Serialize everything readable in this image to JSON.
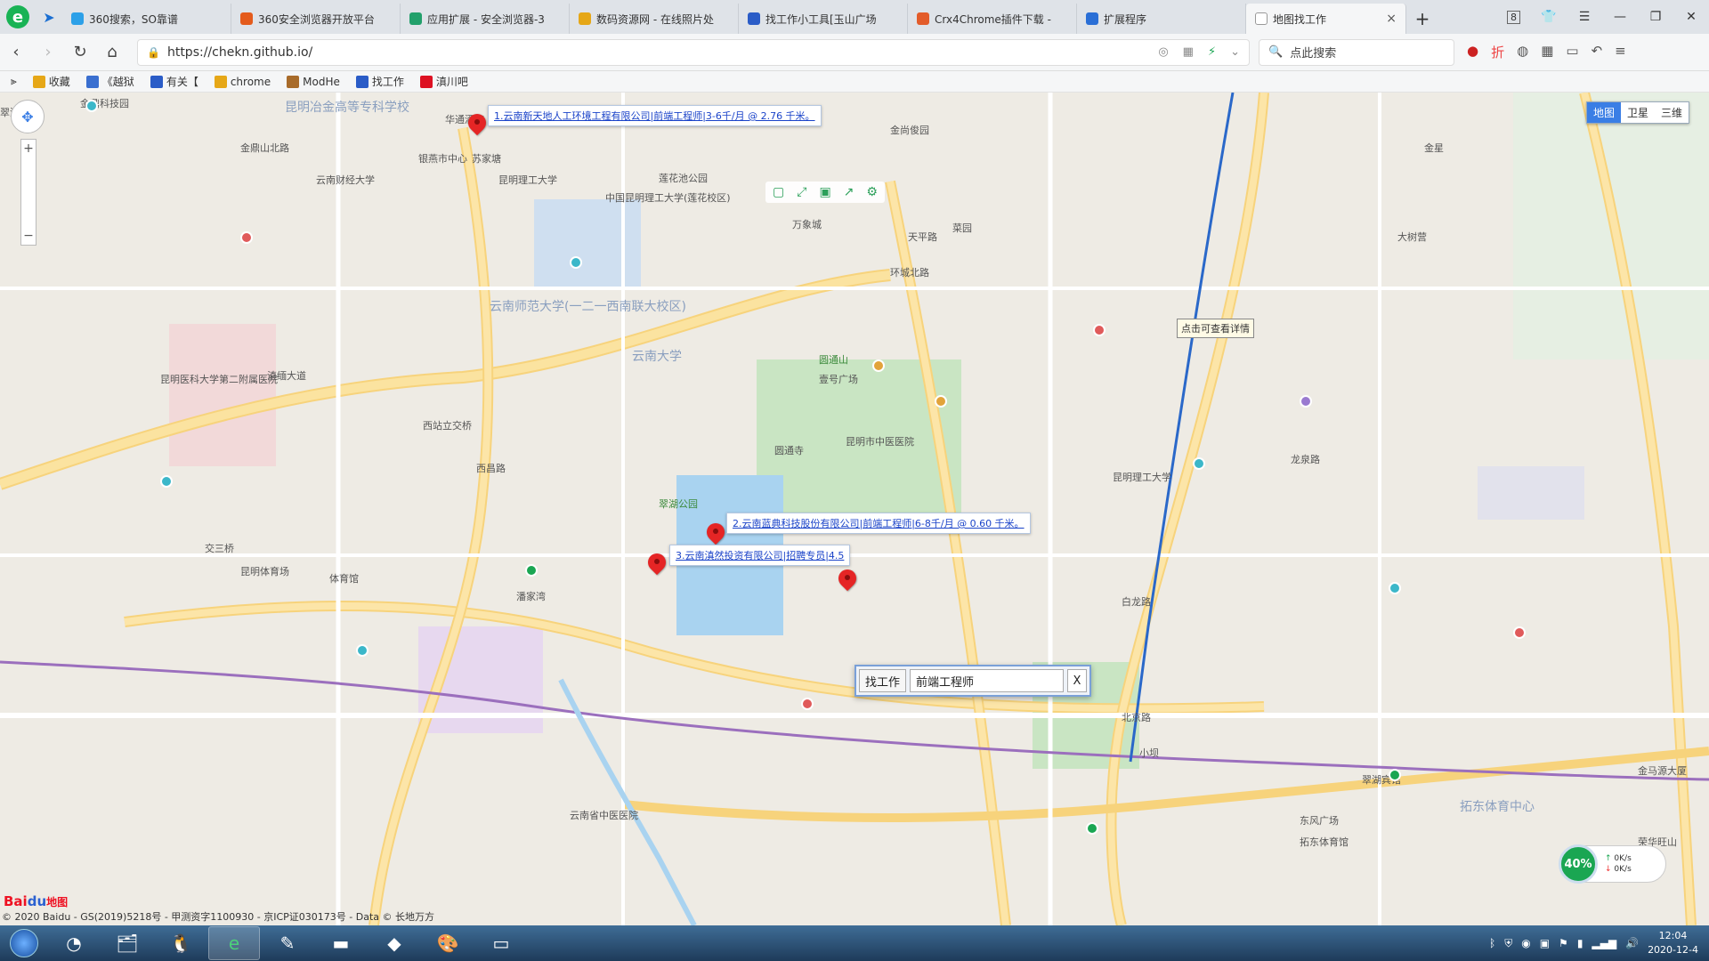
{
  "browser": {
    "tabs": [
      {
        "label": "360搜索，SO靠谱",
        "color": "#2ca0e8",
        "icon": "search-icon"
      },
      {
        "label": "360安全浏览器开放平台",
        "color": "#e45b1c",
        "icon": "grid-icon"
      },
      {
        "label": "应用扩展 - 安全浏览器-3",
        "color": "#22a06b",
        "icon": "extension-icon"
      },
      {
        "label": "数码资源网 - 在线照片处",
        "color": "#e6a717",
        "icon": "folder-icon"
      },
      {
        "label": "找工作小工具[玉山广场",
        "color": "#2a5cc7",
        "icon": "tool-icon"
      },
      {
        "label": "Crx4Chrome插件下载 -",
        "color": "#e35c2a",
        "icon": "rainbow-icon"
      },
      {
        "label": "扩展程序",
        "color": "#2a6fd6",
        "icon": "puzzle-icon"
      }
    ],
    "active_tab": {
      "label": "地图找工作",
      "close": "×"
    },
    "new_tab": "+",
    "tab_count": "8",
    "url": "https://chekn.github.io/",
    "search_placeholder": "点此搜索"
  },
  "bookmarks": [
    {
      "label": "收藏",
      "color": "#e6a717"
    },
    {
      "label": "《越狱",
      "color": "#3a6fd0"
    },
    {
      "label": "有关【",
      "color": "#2a5cc7"
    },
    {
      "label": "chrome",
      "color": "#e6a717"
    },
    {
      "label": "ModHe",
      "color": "#a86b2a"
    },
    {
      "label": "找工作",
      "color": "#2a5cc7"
    },
    {
      "label": "滇川吧",
      "color": "#d12"
    }
  ],
  "map": {
    "map_types": [
      "地图",
      "卫星",
      "三维"
    ],
    "active_map_type": "地图",
    "jobs": [
      {
        "label": "1.云南新天地人工环境工程有限公司|前端工程师|3-6千/月 @ 2.76 千米。"
      },
      {
        "label": "2.云南蓝典科技股份有限公司|前端工程师|6-8千/月 @ 0.60 千米。"
      },
      {
        "label": "3.云南滇然投资有限公司|招聘专员|4.5"
      }
    ],
    "tip": "点击可查看详情",
    "search_widget": {
      "button": "找工作",
      "value": "前端工程师",
      "close": "X"
    },
    "places": [
      "金鼎科技园",
      "昆明冶金高等专科学校",
      "金鼎山北路",
      "苏家塘",
      "华通酒店",
      "银燕市中心",
      "昆明理工大学",
      "云南财经大学",
      "中国昆明理工大学(莲花校区)",
      "莲花池公园",
      "滇缅大道",
      "云南师范大学(一二一西南联大校区)",
      "云南大学",
      "圆通山",
      "翠湖公园",
      "昆明医科大学第二附属医院",
      "西站立交桥",
      "西昌路",
      "昆明体育场",
      "体育馆",
      "潘家湾",
      "昆明理工大学",
      "环城北路",
      "龙泉路",
      "白龙路",
      "北京路",
      "东风广场",
      "拓东体育馆",
      "拓东体育中心",
      "昆明市中医医院",
      "翠湖宾馆",
      "云南省中医医院",
      "金马源大厦",
      "荣华旺山",
      "大树营",
      "金星",
      "金尚俊园",
      "万象城",
      "菜园",
      "天平路",
      "小坝",
      "交三桥",
      "壹号广场",
      "圆通寺",
      "翠湖北路"
    ],
    "speed": {
      "percent": "40%",
      "up": "0K/s",
      "down": "0K/s"
    },
    "baidu_logo": {
      "red": "Bai",
      "blue": "du",
      "tail": "地图"
    },
    "copyright": "© 2020 Baidu - GS(2019)5218号 - 甲测资字1100930 - 京ICP证030173号 - Data © 长地万方"
  },
  "taskbar": {
    "apps": [
      "file-explorer-icon",
      "qq-icon",
      "browser-icon",
      "notepad-icon",
      "terminal-icon",
      "vscode-icon",
      "paint-icon",
      "window-icon"
    ],
    "time": "12:04",
    "date": "2020-12-4"
  }
}
